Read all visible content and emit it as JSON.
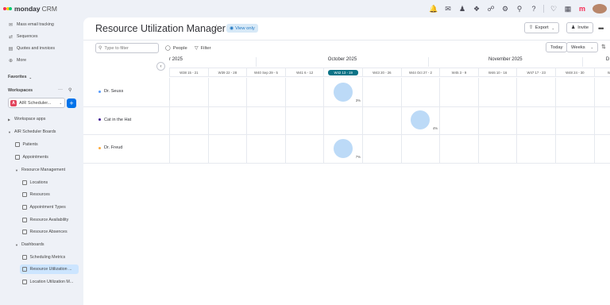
{
  "app": {
    "brand": "monday",
    "product": "CRM"
  },
  "topbar": {
    "icons": [
      "bell-icon",
      "inbox-icon",
      "invite-members-icon",
      "apps-icon",
      "integrations-icon",
      "settings-icon",
      "search-icon",
      "help-icon",
      "heart-icon",
      "grid-menu-icon",
      "monday-logo-icon"
    ]
  },
  "sidebar": {
    "top_items": [
      {
        "label": "Mass email tracking",
        "icon": "email-tracking-icon"
      },
      {
        "label": "Sequences",
        "icon": "sequences-icon"
      },
      {
        "label": "Quotes and invoices",
        "icon": "quotes-icon"
      },
      {
        "label": "More",
        "icon": "more-icon"
      }
    ],
    "favorites_label": "Favorites",
    "workspaces_label": "Workspaces",
    "workspace_name": "AIR Scheduler...",
    "workspace_badge": "A",
    "workspace_apps_label": "Workspace apps",
    "boards_folder": "AIR Scheduler Boards",
    "items": [
      {
        "label": "Patients",
        "level": 1
      },
      {
        "label": "Appointments",
        "level": 1
      },
      {
        "label": "Resource Management",
        "level": 1,
        "folder": true
      },
      {
        "label": "Locations",
        "level": 2
      },
      {
        "label": "Resources",
        "level": 2
      },
      {
        "label": "Appointment Types",
        "level": 2
      },
      {
        "label": "Resource Availability",
        "level": 2
      },
      {
        "label": "Resource Absences",
        "level": 2
      },
      {
        "label": "Dashboards",
        "level": 1,
        "folder": true
      },
      {
        "label": "Scheduling Metrics",
        "level": 2
      },
      {
        "label": "Resource Utilization ...",
        "level": 2,
        "selected": true
      },
      {
        "label": "Location Utilization M...",
        "level": 2
      }
    ]
  },
  "header": {
    "title": "Resource Utilization Manager",
    "view_only": "View only",
    "export_label": "Export",
    "invite_label": "Invite",
    "more_label": "..."
  },
  "toolbar": {
    "search_placeholder": "Type to filter",
    "people_label": "People",
    "filter_label": "Filter",
    "today_label": "Today",
    "scale_label": "Weeks"
  },
  "timeline": {
    "months": [
      "r 2025",
      "October 2025",
      "November 2025",
      "D"
    ],
    "weeks": [
      "W38 15 - 21",
      "W39 22 - 28",
      "W40 Sep 29 - 5",
      "W41 6 - 12",
      "W42 13 - 19",
      "W43 20 - 26",
      "W44 Oct 27 - 2",
      "W45 3 - 9",
      "W46 10 - 16",
      "W47 17 - 23",
      "W48 24 - 30",
      "W49 1 -"
    ],
    "current_week_index": 4,
    "resources": [
      {
        "name": "Dr. Seuss",
        "color": "#579bfc",
        "week_index": 4,
        "percent": "3%"
      },
      {
        "name": "Cat in the Hat",
        "color": "#401694",
        "week_index": 6,
        "percent": "4%"
      },
      {
        "name": "Dr. Freud",
        "color": "#fdab3d",
        "week_index": 4,
        "percent": "7%"
      }
    ]
  }
}
